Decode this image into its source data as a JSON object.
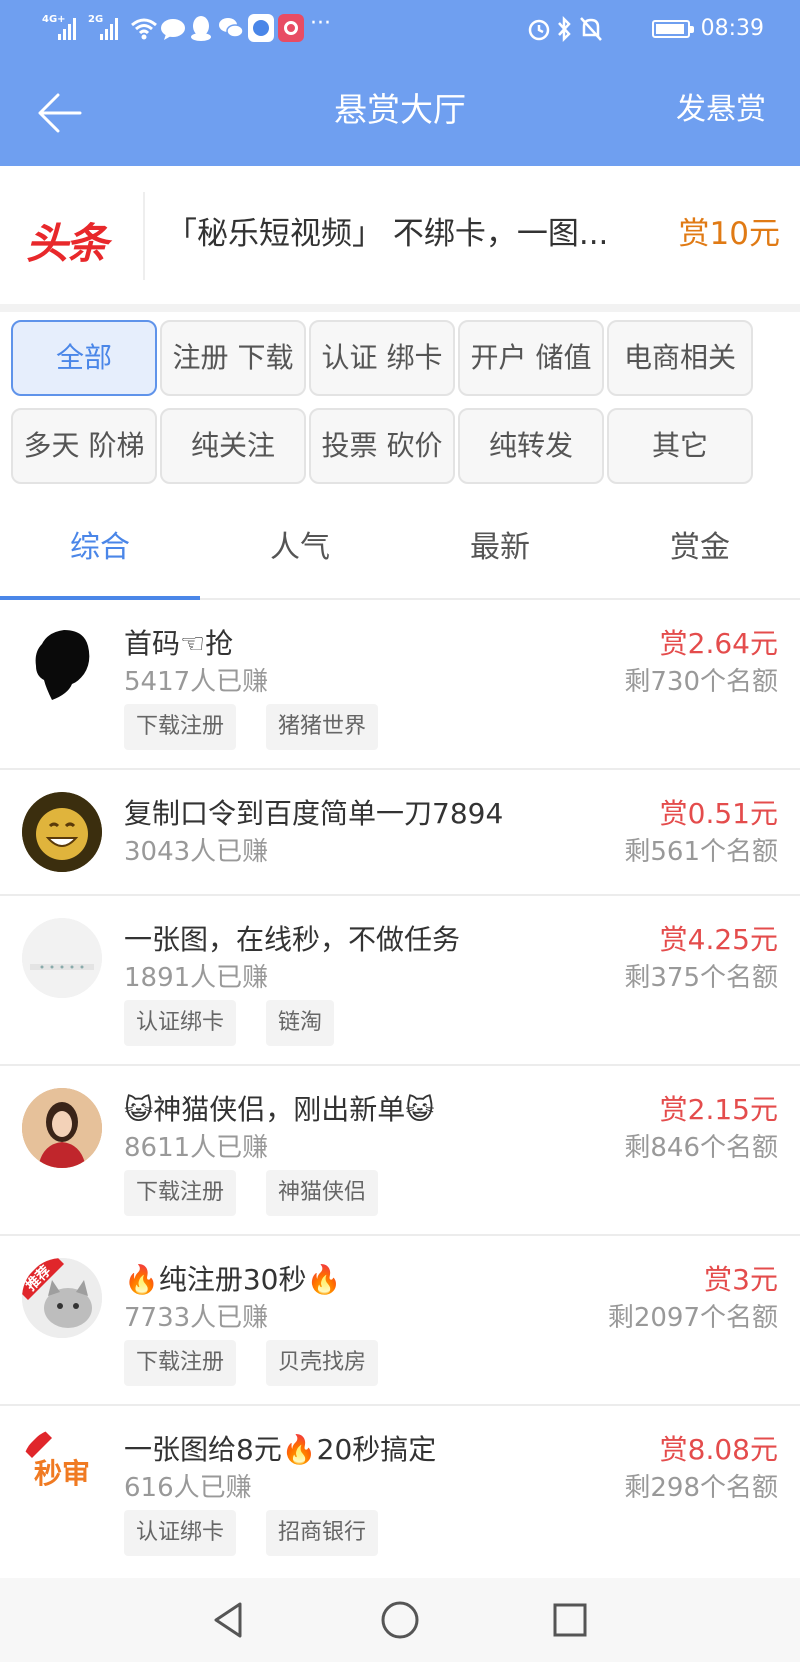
{
  "status_bar": {
    "signal_1": "4G+",
    "signal_2": "2G",
    "icons": [
      "wifi-icon",
      "message-icon",
      "qq-icon",
      "wechat-icon",
      "tieba-app-icon",
      "app-icon",
      "more-dots-icon",
      "alarm-icon",
      "bluetooth-icon",
      "mute-icon",
      "battery-icon"
    ],
    "time": "08:39"
  },
  "app_bar": {
    "title": "悬赏大厅",
    "post_label": "发悬赏",
    "bg_color": "#6f9ff0"
  },
  "headline": {
    "logo": "头条",
    "text": "「秘乐短视频」 不绑卡，一图...",
    "reward": "赏10元"
  },
  "filters": [
    {
      "label": "全部",
      "active": true
    },
    {
      "label": "注册 下载",
      "active": false
    },
    {
      "label": "认证 绑卡",
      "active": false
    },
    {
      "label": "开户 储值",
      "active": false
    },
    {
      "label": "电商相关",
      "active": false
    },
    {
      "label": "多天 阶梯",
      "active": false
    },
    {
      "label": "纯关注",
      "active": false
    },
    {
      "label": "投票 砍价",
      "active": false
    },
    {
      "label": "纯转发",
      "active": false
    },
    {
      "label": "其它",
      "active": false
    }
  ],
  "tabs": [
    {
      "label": "综合",
      "active": true
    },
    {
      "label": "人气",
      "active": false
    },
    {
      "label": "最新",
      "active": false
    },
    {
      "label": "赏金",
      "active": false
    }
  ],
  "tasks": [
    {
      "title": "首码☜抢",
      "earned": "5417人已赚",
      "reward": "赏2.64元",
      "remaining": "剩730个名额",
      "tags": [
        "下载注册",
        "猪猪世界"
      ],
      "avatar": "silhouette-avatar"
    },
    {
      "title": "复制口令到百度简单一刀7894",
      "earned": "3043人已赚",
      "reward": "赏0.51元",
      "remaining": "剩561个名额",
      "tags": [],
      "avatar": "smiley-avatar"
    },
    {
      "title": "一张图，在线秒，不做任务",
      "earned": "1891人已赚",
      "reward": "赏4.25元",
      "remaining": "剩375个名额",
      "tags": [
        "认证绑卡",
        "链淘"
      ],
      "avatar": "device-avatar"
    },
    {
      "title": "😺神猫侠侣，刚出新单😺",
      "earned": "8611人已赚",
      "reward": "赏2.15元",
      "remaining": "剩846个名额",
      "tags": [
        "下载注册",
        "神猫侠侣"
      ],
      "avatar": "photo-avatar"
    },
    {
      "title": "🔥纯注册30秒🔥",
      "earned": "7733人已赚",
      "reward": "赏3元",
      "remaining": "剩2097个名额",
      "tags": [
        "下载注册",
        "贝壳找房"
      ],
      "avatar": "cat-avatar",
      "avatar_badge": "推荐"
    },
    {
      "title": "一张图给8元🔥20秒搞定",
      "earned": "616人已赚",
      "reward": "赏8.08元",
      "remaining": "剩298个名额",
      "tags": [
        "认证绑卡",
        "招商银行"
      ],
      "avatar": "miaoshen-avatar",
      "avatar_text": "秒审"
    }
  ],
  "nav_bar": {
    "buttons": [
      "back-triangle-icon",
      "home-circle-icon",
      "recents-square-icon"
    ]
  },
  "colors": {
    "accent": "#4a86e8",
    "reward_red": "#e44c4c",
    "reward_orange": "#e07a14",
    "headline_logo": "#e8282b"
  }
}
